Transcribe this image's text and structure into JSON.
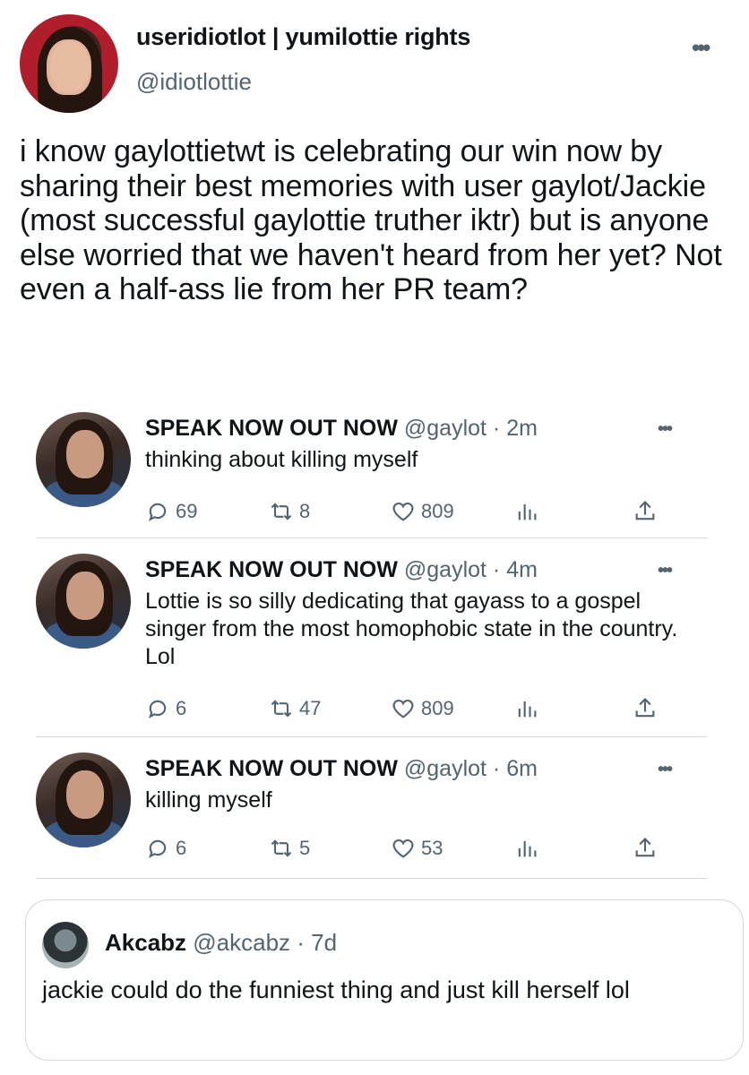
{
  "main_tweet": {
    "display_name": "useridiotlot | yumilottie rights",
    "handle": "@idiotlottie",
    "text": "i know gaylottietwt is celebrating our win now by sharing their best memories with user gaylot/Jackie (most successful gaylottie truther iktr) but is anyone else worried that we haven't heard from her yet? Not even a half-ass lie from her PR team?"
  },
  "embedded_tweets": [
    {
      "name": "SPEAK NOW OUT NOW",
      "meta": "@gaylot · 2m",
      "text": "thinking about killing myself",
      "replies": "69",
      "retweets": "8",
      "likes": "809"
    },
    {
      "name": "SPEAK NOW OUT NOW",
      "meta": "@gaylot · 4m",
      "text": "Lottie is so silly dedicating that gayass to a gospel singer from the most homophobic state in the country. Lol",
      "replies": "6",
      "retweets": "47",
      "likes": "809"
    },
    {
      "name": "SPEAK NOW OUT NOW",
      "meta": "@gaylot · 6m",
      "text": "killing myself",
      "replies": "6",
      "retweets": "5",
      "likes": "53"
    }
  ],
  "quoted_tweet": {
    "name": "Akcabz",
    "meta": "@akcabz · 7d",
    "text": "jackie could do the funniest thing and just kill herself lol"
  },
  "icons": {
    "more": "more-options-icon",
    "reply": "reply-icon",
    "retweet": "retweet-icon",
    "like": "heart-icon",
    "stats": "analytics-icon",
    "share": "share-icon"
  },
  "colors": {
    "text": "#0f1419",
    "secondary": "#536471",
    "divider": "#d6dbde"
  }
}
